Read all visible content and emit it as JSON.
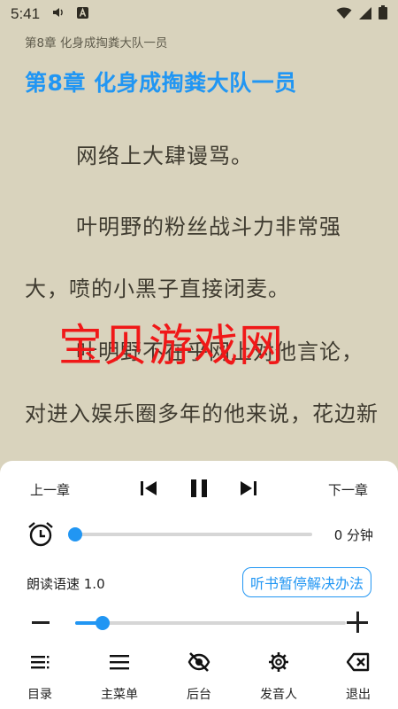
{
  "status_bar": {
    "time": "5:41"
  },
  "reader": {
    "chapter_header": "第8章 化身成掏粪大队一员",
    "chapter_title": "第8章 化身成掏粪大队一员",
    "paragraphs": [
      "网络上大肆谩骂。",
      "叶明野的粉丝战斗力非常强大，喷的小黑子直接闭麦。",
      "叶明野不在乎网上对他言论，对进入娱乐圈多年的他来说，花边新闻是不存在的。"
    ],
    "watermark": "宝贝游戏网"
  },
  "player": {
    "prev_chapter": "上一章",
    "next_chapter": "下一章",
    "timer_value": "0 分钟",
    "timer_level": 0,
    "speed_label": "朗读语速 1.0",
    "speed_level": 0.1,
    "help_button": "听书暂停解决办法"
  },
  "nav": {
    "items": [
      {
        "label": "目录",
        "icon": "toc-icon"
      },
      {
        "label": "主菜单",
        "icon": "menu-icon"
      },
      {
        "label": "后台",
        "icon": "eye-off-icon"
      },
      {
        "label": "发音人",
        "icon": "gear-icon"
      },
      {
        "label": "退出",
        "icon": "backspace-icon"
      }
    ]
  },
  "colors": {
    "accent": "#2196f3",
    "page_bg": "#d9d3bd",
    "watermark": "#f01818"
  }
}
